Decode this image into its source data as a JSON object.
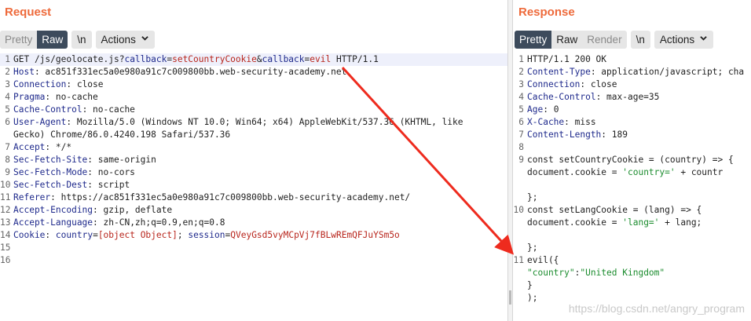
{
  "request": {
    "title": "Request",
    "tabs": {
      "pretty": "Pretty",
      "raw": "Raw",
      "newline": "\\n",
      "actions": "Actions"
    },
    "lines": [
      {
        "n": "1",
        "parts": [
          {
            "t": "GET /js/geolocate.js?"
          },
          {
            "t": "callback",
            "c": "k"
          },
          {
            "t": "="
          },
          {
            "t": "setCountryCookie",
            "c": "v"
          },
          {
            "t": "&"
          },
          {
            "t": "callback",
            "c": "k"
          },
          {
            "t": "="
          },
          {
            "t": "evil",
            "c": "v"
          },
          {
            "t": " HTTP/1.1"
          }
        ]
      },
      {
        "n": "2",
        "parts": [
          {
            "t": "Host",
            "c": "k"
          },
          {
            "t": ": ac851f331ec5a0e980a91c7c009800bb.web-security-academy.net"
          }
        ]
      },
      {
        "n": "3",
        "parts": [
          {
            "t": "Connection",
            "c": "k"
          },
          {
            "t": ": close"
          }
        ]
      },
      {
        "n": "4",
        "parts": [
          {
            "t": "Pragma",
            "c": "k"
          },
          {
            "t": ": no-cache"
          }
        ]
      },
      {
        "n": "5",
        "parts": [
          {
            "t": "Cache-Control",
            "c": "k"
          },
          {
            "t": ": no-cache"
          }
        ]
      },
      {
        "n": "6",
        "parts": [
          {
            "t": "User-Agent",
            "c": "k"
          },
          {
            "t": ": Mozilla/5.0 (Windows NT 10.0; Win64; x64) AppleWebKit/537.36 (KHTML, like"
          }
        ]
      },
      {
        "n": "",
        "parts": [
          {
            "t": "Gecko) Chrome/86.0.4240.198 Safari/537.36"
          }
        ]
      },
      {
        "n": "7",
        "parts": [
          {
            "t": "Accept",
            "c": "k"
          },
          {
            "t": ": */*"
          }
        ]
      },
      {
        "n": "8",
        "parts": [
          {
            "t": "Sec-Fetch-Site",
            "c": "k"
          },
          {
            "t": ": same-origin"
          }
        ]
      },
      {
        "n": "9",
        "parts": [
          {
            "t": "Sec-Fetch-Mode",
            "c": "k"
          },
          {
            "t": ": no-cors"
          }
        ]
      },
      {
        "n": "10",
        "parts": [
          {
            "t": "Sec-Fetch-Dest",
            "c": "k"
          },
          {
            "t": ": script"
          }
        ]
      },
      {
        "n": "11",
        "parts": [
          {
            "t": "Referer",
            "c": "k"
          },
          {
            "t": ": https://ac851f331ec5a0e980a91c7c009800bb.web-security-academy.net/"
          }
        ]
      },
      {
        "n": "12",
        "parts": [
          {
            "t": "Accept-Encoding",
            "c": "k"
          },
          {
            "t": ": gzip, deflate"
          }
        ]
      },
      {
        "n": "13",
        "parts": [
          {
            "t": "Accept-Language",
            "c": "k"
          },
          {
            "t": ": zh-CN,zh;q=0.9,en;q=0.8"
          }
        ]
      },
      {
        "n": "14",
        "parts": [
          {
            "t": "Cookie",
            "c": "k"
          },
          {
            "t": ": "
          },
          {
            "t": "country",
            "c": "k"
          },
          {
            "t": "="
          },
          {
            "t": "[object Object]",
            "c": "cv"
          },
          {
            "t": "; "
          },
          {
            "t": "session",
            "c": "k"
          },
          {
            "t": "="
          },
          {
            "t": "QVeyGsd5vyMCpVj7fBLwREmQFJuYSm5o",
            "c": "cv"
          }
        ]
      },
      {
        "n": "15",
        "parts": []
      },
      {
        "n": "16",
        "parts": []
      }
    ]
  },
  "response": {
    "title": "Response",
    "tabs": {
      "pretty": "Pretty",
      "raw": "Raw",
      "render": "Render",
      "newline": "\\n",
      "actions": "Actions"
    },
    "lines": [
      {
        "n": "1",
        "parts": [
          {
            "t": "HTTP/1.1 200 OK"
          }
        ]
      },
      {
        "n": "2",
        "parts": [
          {
            "t": "Content-Type",
            "c": "k"
          },
          {
            "t": ": application/javascript; cha"
          }
        ]
      },
      {
        "n": "3",
        "parts": [
          {
            "t": "Connection",
            "c": "k"
          },
          {
            "t": ": close"
          }
        ]
      },
      {
        "n": "4",
        "parts": [
          {
            "t": "Cache-Control",
            "c": "k"
          },
          {
            "t": ": max-age=35"
          }
        ]
      },
      {
        "n": "5",
        "parts": [
          {
            "t": "Age",
            "c": "k"
          },
          {
            "t": ": 0"
          }
        ]
      },
      {
        "n": "6",
        "parts": [
          {
            "t": "X-Cache",
            "c": "k"
          },
          {
            "t": ": miss"
          }
        ]
      },
      {
        "n": "7",
        "parts": [
          {
            "t": "Content-Length",
            "c": "k"
          },
          {
            "t": ": 189"
          }
        ]
      },
      {
        "n": "8",
        "parts": []
      },
      {
        "n": "9",
        "parts": [
          {
            "t": "const setCountryCookie = (country) => {"
          }
        ]
      },
      {
        "n": "",
        "parts": [
          {
            "t": "   document.cookie = "
          },
          {
            "t": "'country='",
            "c": "str"
          },
          {
            "t": " + countr"
          }
        ]
      },
      {
        "n": "",
        "parts": []
      },
      {
        "n": "",
        "parts": [
          {
            "t": "};"
          }
        ]
      },
      {
        "n": "10",
        "parts": [
          {
            "t": "const setLangCookie = (lang) => {"
          }
        ]
      },
      {
        "n": "",
        "parts": [
          {
            "t": "   document.cookie = "
          },
          {
            "t": "'lang='",
            "c": "str"
          },
          {
            "t": " + lang;"
          }
        ]
      },
      {
        "n": "",
        "parts": []
      },
      {
        "n": "",
        "parts": [
          {
            "t": "};"
          }
        ]
      },
      {
        "n": "11",
        "parts": [
          {
            "t": "evil({"
          }
        ]
      },
      {
        "n": "",
        "parts": [
          {
            "t": "  "
          },
          {
            "t": "\"country\"",
            "c": "str"
          },
          {
            "t": ":"
          },
          {
            "t": "\"United Kingdom\"",
            "c": "str"
          }
        ]
      },
      {
        "n": "",
        "parts": [
          {
            "t": "}"
          }
        ]
      },
      {
        "n": "",
        "parts": [
          {
            "t": ");"
          }
        ]
      }
    ]
  },
  "watermark": "https://blog.csdn.net/angry_program",
  "colors": {
    "accent": "#ee6a3b",
    "header_key": "#1f2a8c",
    "param_value": "#b8251c",
    "string": "#1b8c2e",
    "arrow": "#ee2b1e"
  }
}
